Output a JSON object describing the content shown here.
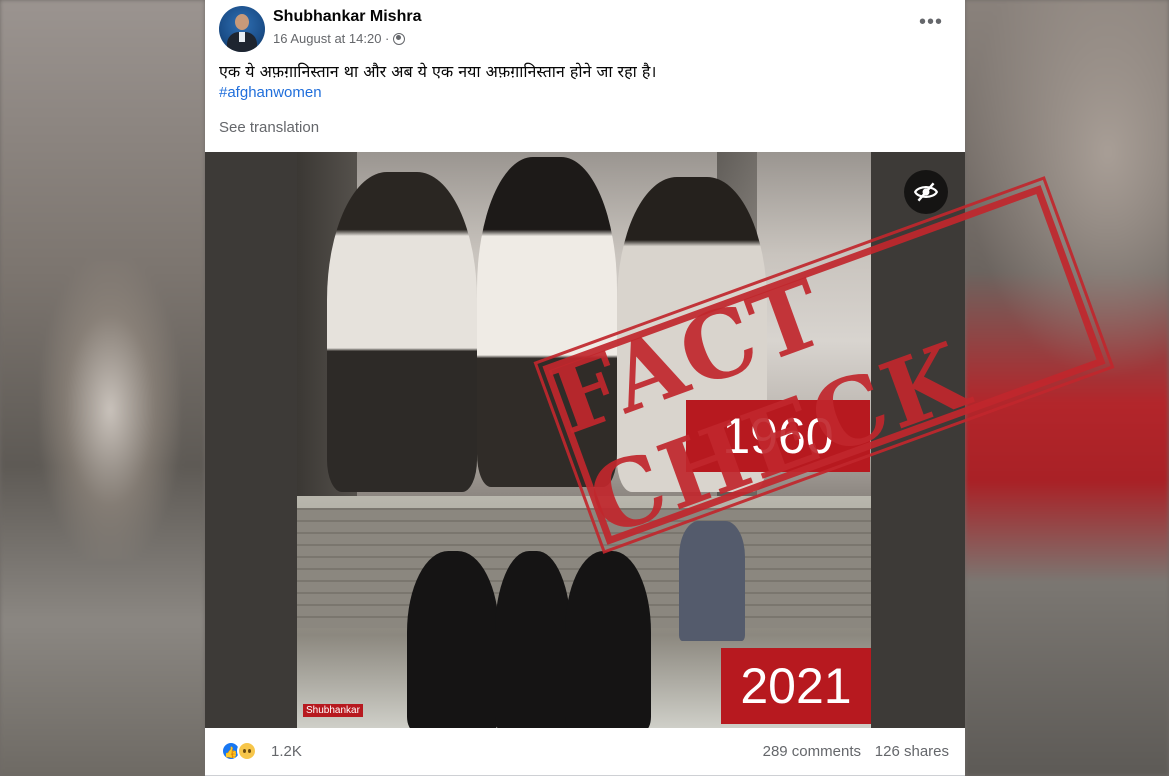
{
  "post": {
    "author": "Shubhankar Mishra",
    "date": "16 August at 14:20 ·",
    "more_label": "•••",
    "text": "एक ये अफ़ग़ानिस्तान था और अब ये एक नया अफ़ग़ानिस्तान होने जा रहा है।",
    "hashtag": "#afghanwomen",
    "see_translation": "See translation"
  },
  "media": {
    "top_year": "1960",
    "bottom_year": "2021",
    "watermark": "Shubhankar"
  },
  "stamp": {
    "text": "FACT CHECK"
  },
  "footer": {
    "reaction_count": "1.2K",
    "comments": "289 comments",
    "shares": "126 shares"
  },
  "colors": {
    "brand_blue": "#1877f2",
    "hashtag_blue": "#216fdb",
    "badge_red": "#b7191f",
    "stamp_red": "#c1272d"
  },
  "icons": [
    "globe-icon",
    "more-options-icon",
    "hide-eye-icon",
    "like-reaction-icon",
    "sad-reaction-icon"
  ]
}
